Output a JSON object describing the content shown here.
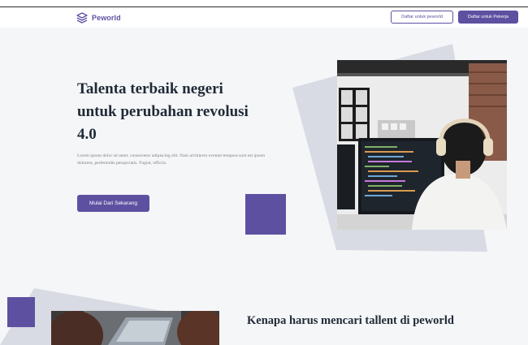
{
  "navbar": {
    "logo_text": "Peworld",
    "btn_worker": "Daftar untuk peworld",
    "btn_recruiter": "Daftar untuk Pekerja"
  },
  "hero": {
    "title": "Talenta terbaik negeri untuk perubahan revolusi 4.0",
    "description": "Lorem ipsum dolor sit amet, consectetur adipiscing elit. Nam architecto eveniet tempora sunt est ipsum dolorem, perferendis perspiciatis. Fugiat, officiis.",
    "cta_label": "Mulai Dari Sekarang",
    "image_icon": "developer-coding-photo"
  },
  "section2": {
    "title": "Kenapa harus mencari tallent di peworld",
    "image_icon": "team-laptop-photo"
  },
  "colors": {
    "brand": "#5e50a1",
    "hero_bg": "#f5f6f8",
    "heading": "#1f2a36",
    "decor_gray": "#d9dbe4"
  }
}
